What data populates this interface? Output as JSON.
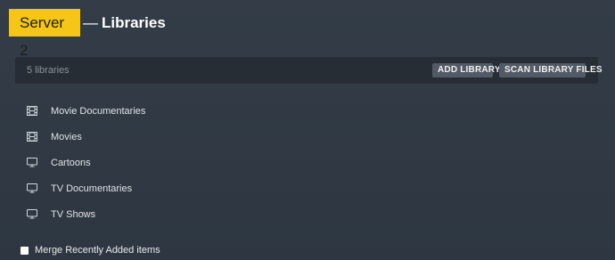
{
  "header": {
    "server_name": "Server 2",
    "separator": "—",
    "title": "Libraries"
  },
  "toolbar": {
    "count_text": "5 libraries",
    "add_label": "ADD LIBRARY",
    "scan_label": "SCAN LIBRARY FILES"
  },
  "libraries": [
    {
      "label": "Movie Documentaries",
      "icon": "film-icon"
    },
    {
      "label": "Movies",
      "icon": "film-icon"
    },
    {
      "label": "Cartoons",
      "icon": "tv-icon"
    },
    {
      "label": "TV Documentaries",
      "icon": "tv-icon"
    },
    {
      "label": "TV Shows",
      "icon": "tv-icon"
    }
  ],
  "options": {
    "merge_label": "Merge Recently Added items",
    "merge_checked": false
  },
  "colors": {
    "badge": "#f5c518",
    "background": "#2f3843",
    "bar": "#262d35",
    "button": "#525b65"
  }
}
